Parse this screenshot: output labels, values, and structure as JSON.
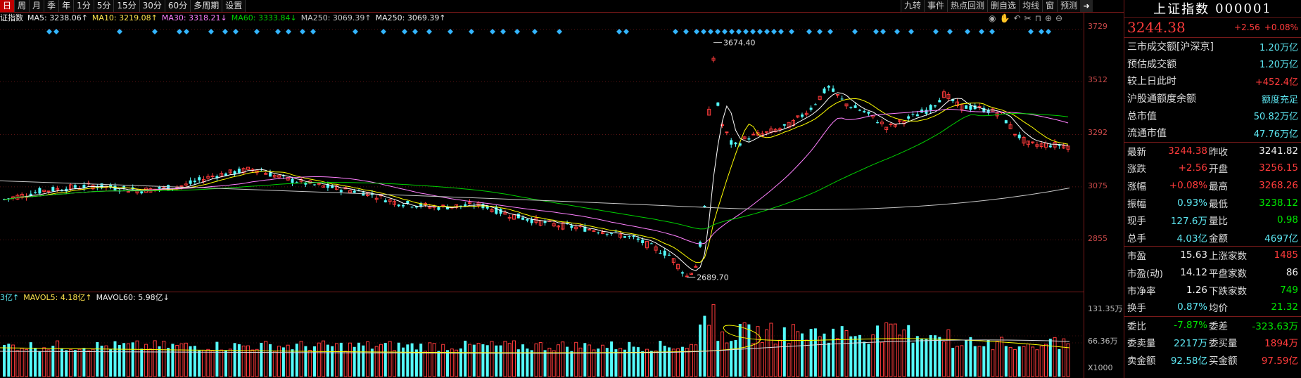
{
  "periods": [
    "日",
    "周",
    "月",
    "季",
    "年",
    "1分",
    "5分",
    "15分",
    "30分",
    "60分",
    "多周期",
    "设置"
  ],
  "tools": [
    "九转",
    "事件",
    "热点回测",
    "删自选",
    "均线",
    "窗",
    "预测"
  ],
  "exit_icon": "exit-arrow-icon",
  "ma_legend": {
    "prefix": "证指数",
    "ma5": "MA5: 3238.06↑",
    "ma10": "MA10: 3219.08↑",
    "ma30": "MA30: 3318.21↓",
    "ma60": "MA60: 3333.84↓",
    "ma250": "MA250: 3069.39↑",
    "ma250b": "MA250: 3069.39↑"
  },
  "vol_legend": {
    "vol": "3亿↑",
    "mavol5": "MAVOL5: 4.18亿↑",
    "mavol60": "MAVOL60: 5.98亿↓"
  },
  "chart_tool_icons": [
    "eye-icon",
    "hand-icon",
    "undo-icon",
    "scissors-icon",
    "lock-icon",
    "zoom-in-icon",
    "zoom-out-icon"
  ],
  "price_axis": [
    "3729",
    "3512",
    "3292",
    "3075",
    "2855"
  ],
  "volume_axis": [
    "131.35万",
    "66.36万",
    "X1000"
  ],
  "annotations": {
    "high": "3674.40",
    "low": "2689.70"
  },
  "colors": {
    "up": "#ff3b3b",
    "down": "#54fcfc",
    "ma5": "#ffffff",
    "ma10": "#ffff00",
    "ma30": "#ff80ff",
    "ma60": "#00d000",
    "ma250": "#c8c8c8",
    "signal": "#33b5ff"
  },
  "panel": {
    "name": "上证指数",
    "code": "000001",
    "price": "3244.38",
    "change": "+2.56",
    "pct": "+0.08%",
    "market_rows": [
      {
        "k": "三市成交额[沪深京]",
        "v": "1.20万亿",
        "c": "cyan"
      },
      {
        "k": "预估成交额",
        "v": "1.20万亿",
        "c": "cyan"
      },
      {
        "k": "较上日此时",
        "v": "+452.4亿",
        "c": "red"
      },
      {
        "k": "沪股通额度余额",
        "v": "额度充足",
        "c": "cyan"
      },
      {
        "k": "总市值",
        "v": "50.82万亿",
        "c": "cyan"
      },
      {
        "k": "流通市值",
        "v": "47.76万亿",
        "c": "cyan"
      }
    ],
    "quote_rows": [
      {
        "k1": "最新",
        "v1": "3244.38",
        "c1": "red",
        "k2": "昨收",
        "v2": "3241.82",
        "c2": "white"
      },
      {
        "k1": "涨跌",
        "v1": "+2.56",
        "c1": "red",
        "k2": "开盘",
        "v2": "3256.15",
        "c2": "red"
      },
      {
        "k1": "涨幅",
        "v1": "+0.08%",
        "c1": "red",
        "k2": "最高",
        "v2": "3268.26",
        "c2": "red"
      },
      {
        "k1": "振幅",
        "v1": "0.93%",
        "c1": "cyan",
        "k2": "最低",
        "v2": "3238.12",
        "c2": "green"
      },
      {
        "k1": "现手",
        "v1": "127.6万",
        "c1": "cyan",
        "k2": "量比",
        "v2": "0.98",
        "c2": "green"
      },
      {
        "k1": "总手",
        "v1": "4.03亿",
        "c1": "cyan",
        "k2": "金额",
        "v2": "4697亿",
        "c2": "cyan"
      }
    ],
    "breadth_rows": [
      {
        "k1": "市盈",
        "v1": "15.63",
        "c1": "white",
        "k2": "上涨家数",
        "v2": "1485",
        "c2": "red"
      },
      {
        "k1": "市盈(动)",
        "v1": "14.12",
        "c1": "white",
        "k2": "平盘家数",
        "v2": "86",
        "c2": "white"
      },
      {
        "k1": "市净率",
        "v1": "1.26",
        "c1": "white",
        "k2": "下跌家数",
        "v2": "749",
        "c2": "green"
      },
      {
        "k1": "换手",
        "v1": "0.87%",
        "c1": "cyan",
        "k2": "均价",
        "v2": "21.32",
        "c2": "green"
      }
    ],
    "order_rows": [
      {
        "k1": "委比",
        "v1": "-7.87%",
        "c1": "green",
        "k2": "委差",
        "v2": "-323.63万",
        "c2": "green"
      },
      {
        "k1": "委卖量",
        "v1": "2217万",
        "c1": "cyan",
        "k2": "委买量",
        "v2": "1894万",
        "c2": "red"
      },
      {
        "k1": "卖金额",
        "v1": "92.58亿",
        "c1": "cyan",
        "k2": "买金额",
        "v2": "97.59亿",
        "c2": "red"
      }
    ]
  }
}
